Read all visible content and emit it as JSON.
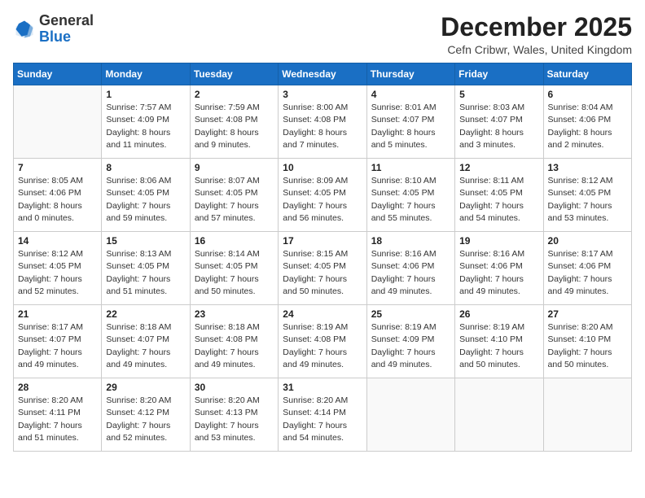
{
  "header": {
    "logo_general": "General",
    "logo_blue": "Blue",
    "month_title": "December 2025",
    "location": "Cefn Cribwr, Wales, United Kingdom"
  },
  "weekdays": [
    "Sunday",
    "Monday",
    "Tuesday",
    "Wednesday",
    "Thursday",
    "Friday",
    "Saturday"
  ],
  "weeks": [
    [
      {
        "day": "",
        "info": ""
      },
      {
        "day": "1",
        "info": "Sunrise: 7:57 AM\nSunset: 4:09 PM\nDaylight: 8 hours\nand 11 minutes."
      },
      {
        "day": "2",
        "info": "Sunrise: 7:59 AM\nSunset: 4:08 PM\nDaylight: 8 hours\nand 9 minutes."
      },
      {
        "day": "3",
        "info": "Sunrise: 8:00 AM\nSunset: 4:08 PM\nDaylight: 8 hours\nand 7 minutes."
      },
      {
        "day": "4",
        "info": "Sunrise: 8:01 AM\nSunset: 4:07 PM\nDaylight: 8 hours\nand 5 minutes."
      },
      {
        "day": "5",
        "info": "Sunrise: 8:03 AM\nSunset: 4:07 PM\nDaylight: 8 hours\nand 3 minutes."
      },
      {
        "day": "6",
        "info": "Sunrise: 8:04 AM\nSunset: 4:06 PM\nDaylight: 8 hours\nand 2 minutes."
      }
    ],
    [
      {
        "day": "7",
        "info": "Sunrise: 8:05 AM\nSunset: 4:06 PM\nDaylight: 8 hours\nand 0 minutes."
      },
      {
        "day": "8",
        "info": "Sunrise: 8:06 AM\nSunset: 4:05 PM\nDaylight: 7 hours\nand 59 minutes."
      },
      {
        "day": "9",
        "info": "Sunrise: 8:07 AM\nSunset: 4:05 PM\nDaylight: 7 hours\nand 57 minutes."
      },
      {
        "day": "10",
        "info": "Sunrise: 8:09 AM\nSunset: 4:05 PM\nDaylight: 7 hours\nand 56 minutes."
      },
      {
        "day": "11",
        "info": "Sunrise: 8:10 AM\nSunset: 4:05 PM\nDaylight: 7 hours\nand 55 minutes."
      },
      {
        "day": "12",
        "info": "Sunrise: 8:11 AM\nSunset: 4:05 PM\nDaylight: 7 hours\nand 54 minutes."
      },
      {
        "day": "13",
        "info": "Sunrise: 8:12 AM\nSunset: 4:05 PM\nDaylight: 7 hours\nand 53 minutes."
      }
    ],
    [
      {
        "day": "14",
        "info": "Sunrise: 8:12 AM\nSunset: 4:05 PM\nDaylight: 7 hours\nand 52 minutes."
      },
      {
        "day": "15",
        "info": "Sunrise: 8:13 AM\nSunset: 4:05 PM\nDaylight: 7 hours\nand 51 minutes."
      },
      {
        "day": "16",
        "info": "Sunrise: 8:14 AM\nSunset: 4:05 PM\nDaylight: 7 hours\nand 50 minutes."
      },
      {
        "day": "17",
        "info": "Sunrise: 8:15 AM\nSunset: 4:05 PM\nDaylight: 7 hours\nand 50 minutes."
      },
      {
        "day": "18",
        "info": "Sunrise: 8:16 AM\nSunset: 4:06 PM\nDaylight: 7 hours\nand 49 minutes."
      },
      {
        "day": "19",
        "info": "Sunrise: 8:16 AM\nSunset: 4:06 PM\nDaylight: 7 hours\nand 49 minutes."
      },
      {
        "day": "20",
        "info": "Sunrise: 8:17 AM\nSunset: 4:06 PM\nDaylight: 7 hours\nand 49 minutes."
      }
    ],
    [
      {
        "day": "21",
        "info": "Sunrise: 8:17 AM\nSunset: 4:07 PM\nDaylight: 7 hours\nand 49 minutes."
      },
      {
        "day": "22",
        "info": "Sunrise: 8:18 AM\nSunset: 4:07 PM\nDaylight: 7 hours\nand 49 minutes."
      },
      {
        "day": "23",
        "info": "Sunrise: 8:18 AM\nSunset: 4:08 PM\nDaylight: 7 hours\nand 49 minutes."
      },
      {
        "day": "24",
        "info": "Sunrise: 8:19 AM\nSunset: 4:08 PM\nDaylight: 7 hours\nand 49 minutes."
      },
      {
        "day": "25",
        "info": "Sunrise: 8:19 AM\nSunset: 4:09 PM\nDaylight: 7 hours\nand 49 minutes."
      },
      {
        "day": "26",
        "info": "Sunrise: 8:19 AM\nSunset: 4:10 PM\nDaylight: 7 hours\nand 50 minutes."
      },
      {
        "day": "27",
        "info": "Sunrise: 8:20 AM\nSunset: 4:10 PM\nDaylight: 7 hours\nand 50 minutes."
      }
    ],
    [
      {
        "day": "28",
        "info": "Sunrise: 8:20 AM\nSunset: 4:11 PM\nDaylight: 7 hours\nand 51 minutes."
      },
      {
        "day": "29",
        "info": "Sunrise: 8:20 AM\nSunset: 4:12 PM\nDaylight: 7 hours\nand 52 minutes."
      },
      {
        "day": "30",
        "info": "Sunrise: 8:20 AM\nSunset: 4:13 PM\nDaylight: 7 hours\nand 53 minutes."
      },
      {
        "day": "31",
        "info": "Sunrise: 8:20 AM\nSunset: 4:14 PM\nDaylight: 7 hours\nand 54 minutes."
      },
      {
        "day": "",
        "info": ""
      },
      {
        "day": "",
        "info": ""
      },
      {
        "day": "",
        "info": ""
      }
    ]
  ]
}
